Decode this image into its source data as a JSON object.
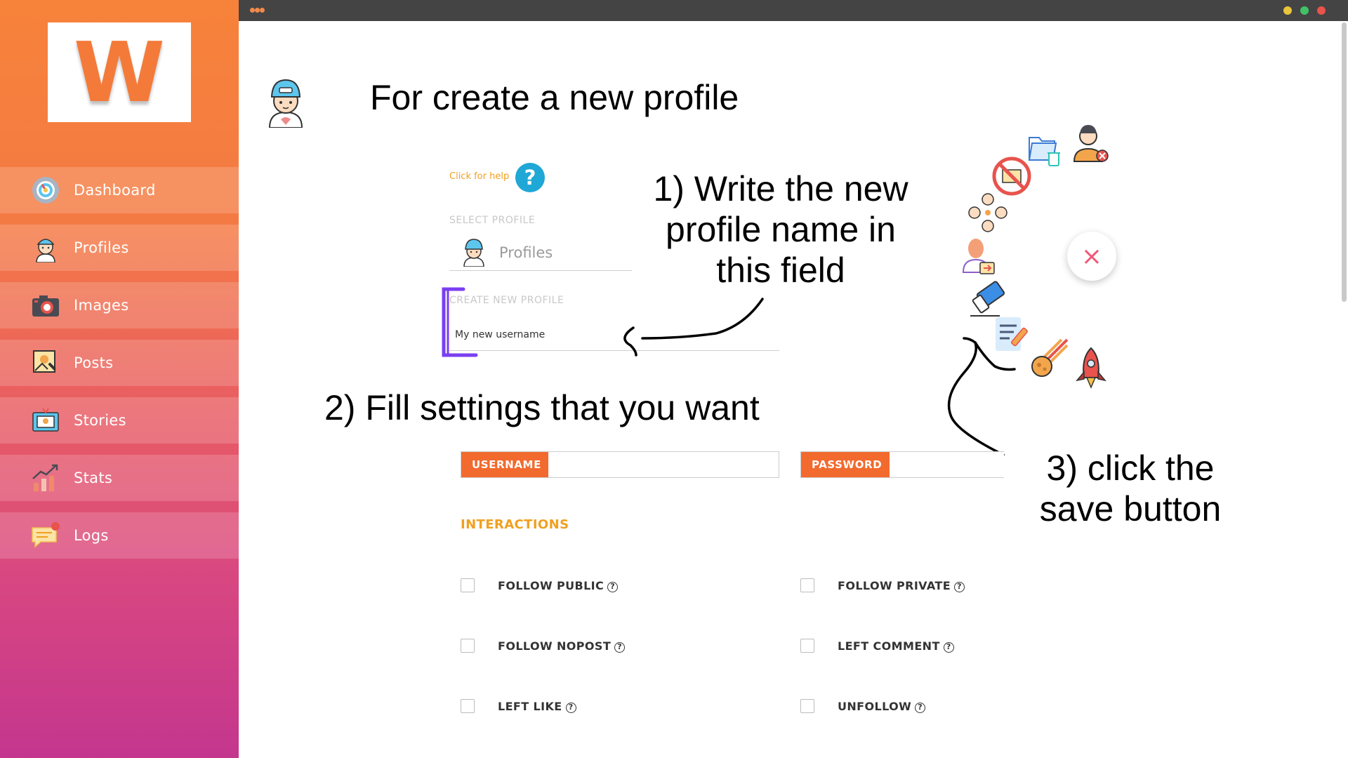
{
  "logo": {
    "letter": "W"
  },
  "sidebar": {
    "items": [
      {
        "label": "Dashboard",
        "icon": "dashboard-gauge-icon"
      },
      {
        "label": "Profiles",
        "icon": "profile-avatar-icon"
      },
      {
        "label": "Images",
        "icon": "camera-icon"
      },
      {
        "label": "Posts",
        "icon": "post-picture-icon"
      },
      {
        "label": "Stories",
        "icon": "stories-icon"
      },
      {
        "label": "Stats",
        "icon": "stats-chart-icon"
      },
      {
        "label": "Logs",
        "icon": "logs-chat-icon"
      }
    ]
  },
  "annotations": {
    "title": "For create a new profile",
    "step1": "1) Write the new profile name in this field",
    "step2": "2) Fill settings that you want",
    "step3": "3) click the save button"
  },
  "form": {
    "help_text": "Click for help",
    "help_icon": "?",
    "select_label": "SELECT PROFILE",
    "select_value": "Profiles",
    "create_label": "CREATE NEW PROFILE",
    "new_profile_value": "My new username",
    "username_label": "USERNAME",
    "password_label": "PASSWORD",
    "interactions_heading": "INTERACTIONS",
    "checkboxes": [
      {
        "label": "FOLLOW PUBLIC",
        "checked": false
      },
      {
        "label": "FOLLOW PRIVATE",
        "checked": false
      },
      {
        "label": "FOLLOW NOPOST",
        "checked": false
      },
      {
        "label": "LEFT COMMENT",
        "checked": false
      },
      {
        "label": "LEFT LIKE",
        "checked": false
      },
      {
        "label": "UNFOLLOW",
        "checked": false
      }
    ]
  },
  "fab_menu": {
    "close_symbol": "×",
    "icons": [
      "delete-folder-icon",
      "remove-user-icon",
      "no-images-icon",
      "group-users-icon",
      "user-export-icon",
      "eraser-icon",
      "edit-document-icon",
      "meteor-icon",
      "rocket-icon"
    ]
  },
  "colors": {
    "accent_orange": "#f26a2e",
    "heading_amber": "#f0a020",
    "help_blue": "#1fa7d6",
    "close_pink": "#f0587a",
    "annotation_purple": "#7a3ff0"
  }
}
